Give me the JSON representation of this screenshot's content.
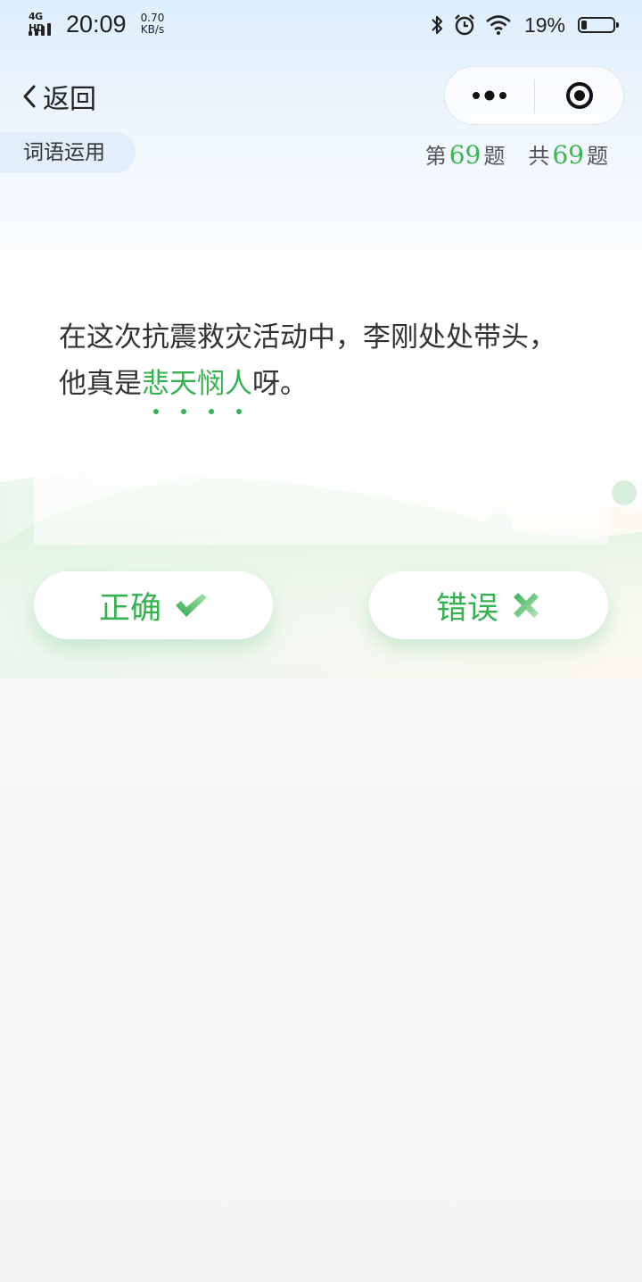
{
  "status_bar": {
    "network": "4G HD",
    "time": "20:09",
    "speed_value": "0.70",
    "speed_unit": "KB/s",
    "battery_percent": "19%",
    "battery_level": 0.19
  },
  "nav": {
    "back_label": "返回"
  },
  "header": {
    "category": "词语运用",
    "progress_prefix": "第",
    "current": "69",
    "progress_suffix": "题",
    "total_prefix": "共",
    "total": "69",
    "total_suffix": "题"
  },
  "question": {
    "text_before": "在这次抗震救灾活动中，李刚处处带头，他真是",
    "keyword": [
      "悲",
      "天",
      "悯",
      "人"
    ],
    "text_after": "呀。"
  },
  "answers": {
    "correct_label": "正确",
    "wrong_label": "错误"
  },
  "colors": {
    "accent": "#36b14f",
    "header_bg": "#deeefc",
    "tag_bg": "#e2effb"
  }
}
